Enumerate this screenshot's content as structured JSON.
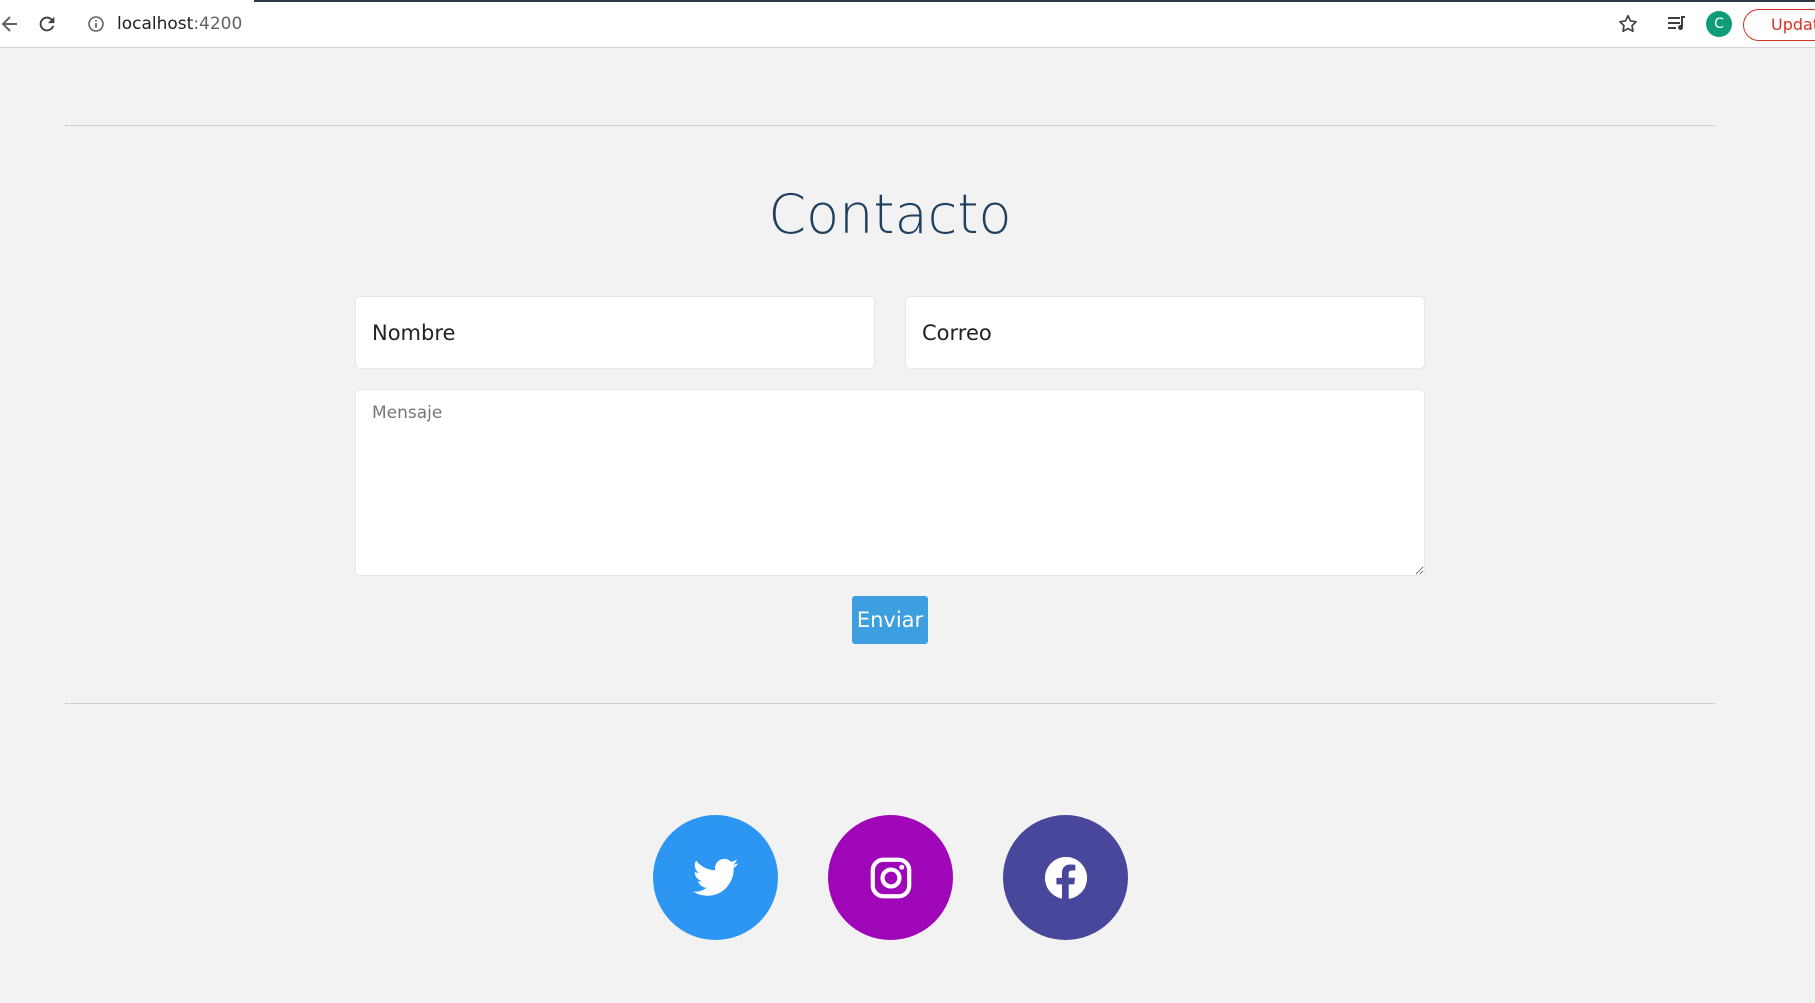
{
  "browser": {
    "url_host": "localhost",
    "url_port": ":4200",
    "avatar_letter": "C",
    "update_label": "Update"
  },
  "page": {
    "title": "Contacto",
    "form": {
      "name_placeholder": "Nombre",
      "email_placeholder": "Correo",
      "message_placeholder": "Mensaje",
      "submit_label": "Enviar"
    },
    "social": [
      {
        "name": "twitter",
        "icon": "twitter-icon",
        "color": "#2d96f2"
      },
      {
        "name": "instagram",
        "icon": "instagram-icon",
        "color": "#9e06b8"
      },
      {
        "name": "facebook",
        "icon": "facebook-icon",
        "color": "#48479c"
      }
    ]
  },
  "colors": {
    "background": "#f2f2f2",
    "title": "#1e3f5e",
    "button": "#3d9ee0"
  }
}
